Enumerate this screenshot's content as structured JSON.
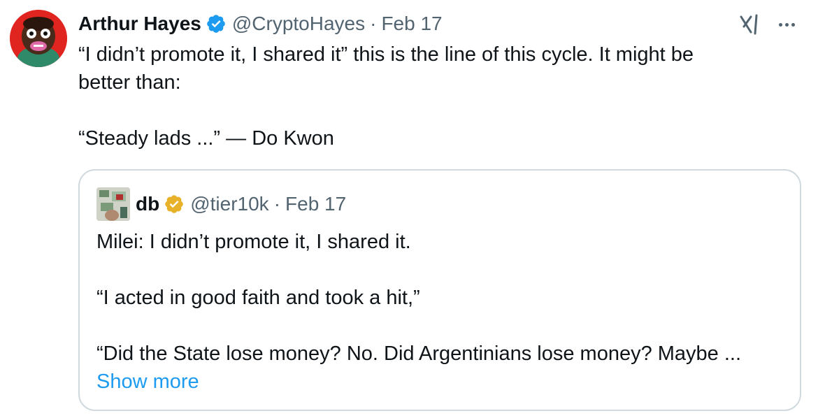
{
  "tweet": {
    "author_name": "Arthur Hayes",
    "author_handle": "@CryptoHayes",
    "separator": "·",
    "date": "Feb 17",
    "text_lines": [
      "“I didn’t promote it, I shared it” this is the line of this cycle. It might be",
      "better than:",
      "“Steady lads ...” — Do Kwon"
    ],
    "verified_icon": "blue-verified-badge-icon",
    "menu_icons": [
      "grok-icon",
      "more-options-icon"
    ]
  },
  "quoted_tweet": {
    "author_name": "db",
    "author_handle": "@tier10k",
    "separator": "·",
    "date": "Feb 17",
    "verified_icon": "gold-verified-badge-icon",
    "text_lines": [
      "Milei: I didn’t promote it, I shared it.",
      "“I acted in good faith and took a hit,”",
      "“Did the State lose money? No. Did Argentinians lose money? Maybe ..."
    ],
    "show_more_label": "Show more"
  },
  "colors": {
    "link": "#1d9bf0",
    "secondary_text": "#536471",
    "border": "#cfd9de",
    "avatar_bg": "#e0241f",
    "gold_badge": "#e8b12a",
    "blue_badge": "#1d9bf0"
  }
}
